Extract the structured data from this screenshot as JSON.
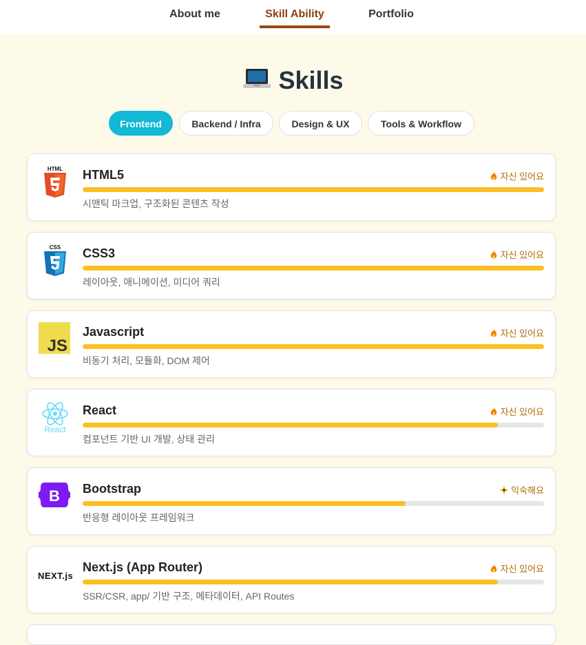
{
  "nav": {
    "items": [
      {
        "label": "About me",
        "active": false
      },
      {
        "label": "Skill Ability",
        "active": true
      },
      {
        "label": "Portfolio",
        "active": false
      }
    ]
  },
  "header": {
    "title": "Skills",
    "icon": "laptop-icon"
  },
  "tabs": [
    {
      "label": "Frontend",
      "active": true
    },
    {
      "label": "Backend / Infra",
      "active": false
    },
    {
      "label": "Design & UX",
      "active": false
    },
    {
      "label": "Tools & Workflow",
      "active": false
    }
  ],
  "skills": [
    {
      "name": "HTML5",
      "level": "자신 있어요",
      "level_icon": "fire-icon",
      "progress": 1.0,
      "desc": "시맨틱 마크업, 구조화된 콘텐츠 작성",
      "logo": "html5-logo",
      "logo_text": "HTML"
    },
    {
      "name": "CSS3",
      "level": "자신 있어요",
      "level_icon": "fire-icon",
      "progress": 1.0,
      "desc": "레이아웃, 애니메이션, 미디어 쿼리",
      "logo": "css3-logo",
      "logo_text": "CSS"
    },
    {
      "name": "Javascript",
      "level": "자신 있어요",
      "level_icon": "fire-icon",
      "progress": 1.0,
      "desc": "비동기 처리, 모듈화, DOM 제어",
      "logo": "javascript-logo",
      "logo_text": "JS"
    },
    {
      "name": "React",
      "level": "자신 있어요",
      "level_icon": "fire-icon",
      "progress": 0.9,
      "desc": "컴포넌트 기반 UI 개발, 상태 관리",
      "logo": "react-logo",
      "logo_text": "React"
    },
    {
      "name": "Bootstrap",
      "level": "익숙해요",
      "level_icon": "sparkle-icon",
      "progress": 0.7,
      "desc": "반응형 레이아웃 프레임워크",
      "logo": "bootstrap-logo",
      "logo_text": "B"
    },
    {
      "name": "Next.js (App Router)",
      "level": "자신 있어요",
      "level_icon": "fire-icon",
      "progress": 0.9,
      "desc": "SSR/CSR, app/ 기반 구조, 메타데이터, API Routes",
      "logo": "nextjs-logo",
      "logo_text": "NEXT.js"
    }
  ],
  "colors": {
    "accent": "#12b8d4",
    "bar": "#fbbf24",
    "nav_active": "#8c3f12",
    "bg": "#fefaea"
  }
}
